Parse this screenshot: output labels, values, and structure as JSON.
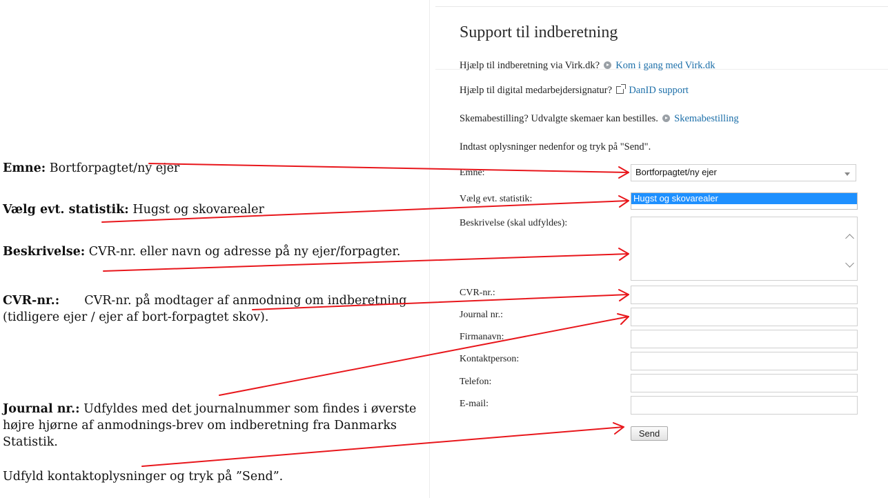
{
  "notes": {
    "emne_label": "Emne:",
    "emne_text": " Bortforpagtet/ny ejer",
    "stat_label": "Vælg evt. statistik:",
    "stat_text": " Hugst og skovarealer",
    "beskr_label": "Beskrivelse:",
    "beskr_text": " CVR-nr. eller navn og adresse på ny ejer/forpagter.",
    "cvr_label": "CVR-nr.:",
    "cvr_text": "CVR-nr. på modtager af anmodning om indberetning (tidligere ejer / ejer af bort-forpagtet skov).",
    "journal_label": "Journal nr.:",
    "journal_text": " Udfyldes med det journalnummer som findes i øverste højre hjørne af anmodnings-brev om indberetning fra Danmarks Statistik.",
    "bottom_text": "Udfyld kontaktoplysninger og tryk på ”Send”."
  },
  "panel": {
    "title": "Support til indberetning",
    "info1_text": "Hjælp til indberetning via Virk.dk?",
    "info1_link": "Kom i gang med Virk.dk",
    "info2_text": "Hjælp til digital medarbejdersignatur?",
    "info2_link": "DanID support",
    "info3_text": "Skemabestilling? Udvalgte skemaer kan bestilles.",
    "info3_link": "Skemabestilling",
    "instruction": "Indtast oplysninger nedenfor og tryk på \"Send\"."
  },
  "form": {
    "emne_label": "Emne:",
    "emne_value": "Bortforpagtet/ny ejer",
    "stat_label": "Vælg evt. statistik:",
    "stat_value": "Hugst og skovarealer",
    "beskr_label": "Beskrivelse (skal udfyldes):",
    "cvr_label": "CVR-nr.:",
    "journal_label": "Journal nr.:",
    "firma_label": "Firmanavn:",
    "kontakt_label": "Kontaktperson:",
    "tel_label": "Telefon:",
    "email_label": "E-mail:",
    "send_label": "Send"
  },
  "colors": {
    "link": "#1b6ea8",
    "selected_option": "#1e90ff",
    "callout_arrow": "#e8161b"
  },
  "icons": {
    "circle_arrow": "arrow-circle-icon",
    "external_link": "external-link-icon"
  }
}
